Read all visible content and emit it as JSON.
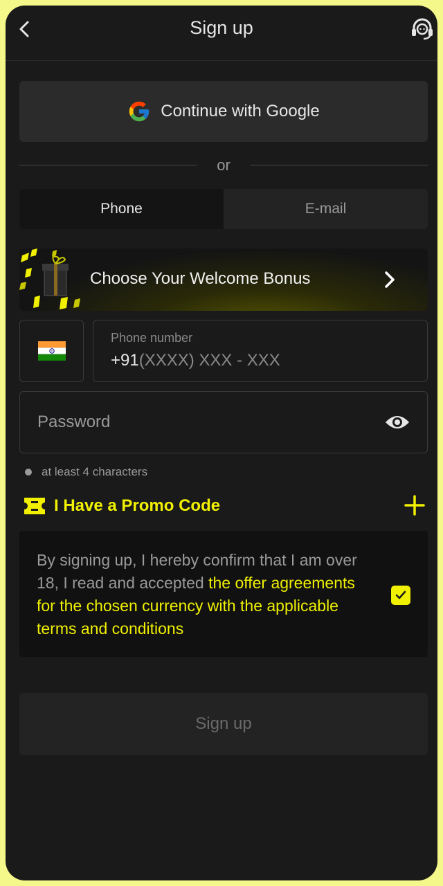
{
  "header": {
    "title": "Sign up",
    "back_icon": "chevron-left-icon",
    "support_icon": "headset-icon"
  },
  "google": {
    "label": "Continue with Google",
    "icon": "google-icon"
  },
  "divider": {
    "text": "or"
  },
  "tabs": [
    {
      "label": "Phone",
      "active": true
    },
    {
      "label": "E-mail",
      "active": false
    }
  ],
  "bonus": {
    "label": "Choose Your Welcome Bonus",
    "icon": "gift-icon"
  },
  "phone": {
    "country_flag": "india-flag-icon",
    "label": "Phone number",
    "code": "+91",
    "mask": "(XXXX) XXX - XXX"
  },
  "password": {
    "placeholder": "Password",
    "icon": "eye-icon"
  },
  "password_hint": "at least 4 characters",
  "promo": {
    "label": "I Have a Promo Code",
    "icon": "ticket-icon",
    "action_icon": "plus-icon"
  },
  "terms": {
    "text_plain": "By signing up, I hereby confirm that I am over 18, I read and accepted ",
    "text_link": "the offer agreements for the chosen currency with the applicable terms and conditions",
    "checked": true
  },
  "signup_button": {
    "label": "Sign up"
  },
  "colors": {
    "accent": "#f0f000",
    "background": "#1a1a1a",
    "frame": "#f4f78a"
  }
}
